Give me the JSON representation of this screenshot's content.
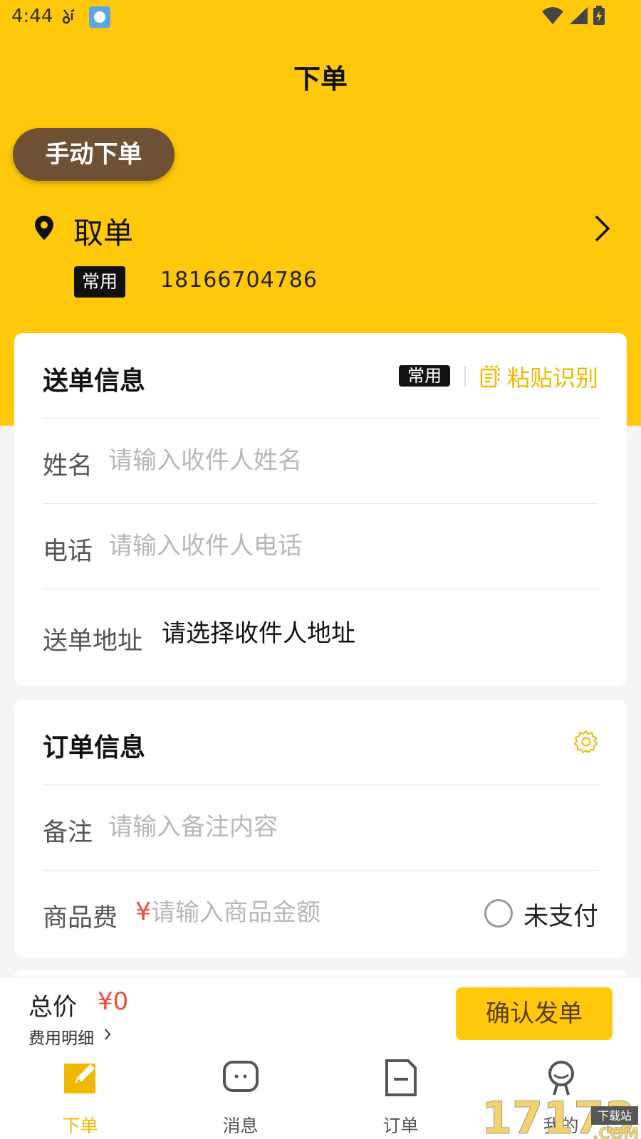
{
  "status_bar": {
    "time": "4:44",
    "notification_icons": [
      "moped-icon",
      "app-icon"
    ],
    "system_icons": [
      "wifi-icon",
      "signal-icon",
      "battery-charging-icon"
    ]
  },
  "header": {
    "title": "下单"
  },
  "mode_button": {
    "label": "手动下单"
  },
  "pickup": {
    "label": "取单",
    "tag": "常用",
    "phone": "18166704786"
  },
  "send_card": {
    "title": "送单信息",
    "tag": "常用",
    "paste_label": "粘贴识别",
    "name_label": "姓名",
    "name_placeholder": "请输入收件人姓名",
    "phone_label": "电话",
    "phone_placeholder": "请输入收件人电话",
    "address_label": "送单地址",
    "address_value": "请选择收件人地址"
  },
  "order_card": {
    "title": "订单信息",
    "remark_label": "备注",
    "remark_placeholder": "请输入备注内容",
    "goods_label": "商品费",
    "currency": "¥",
    "goods_placeholder": "请输入商品金额",
    "unpaid_label": "未支付"
  },
  "footer": {
    "total_label": "总价",
    "total_value": "¥0",
    "fee_detail": "费用明细",
    "confirm_label": "确认发单"
  },
  "tabs": [
    {
      "label": "下单",
      "icon": "edit-icon",
      "active": true
    },
    {
      "label": "消息",
      "icon": "message-icon",
      "active": false
    },
    {
      "label": "订单",
      "icon": "document-icon",
      "active": false
    },
    {
      "label": "我的",
      "icon": "profile-icon",
      "active": false
    }
  ],
  "colors": {
    "brand_yellow": "#ffc80a",
    "brown": "#6e5134",
    "price_red": "#f04a3a",
    "accent_text": "#f0b800"
  },
  "watermark": {
    "text": "17173",
    "subtext": "下载站",
    "domain": ".COM"
  }
}
